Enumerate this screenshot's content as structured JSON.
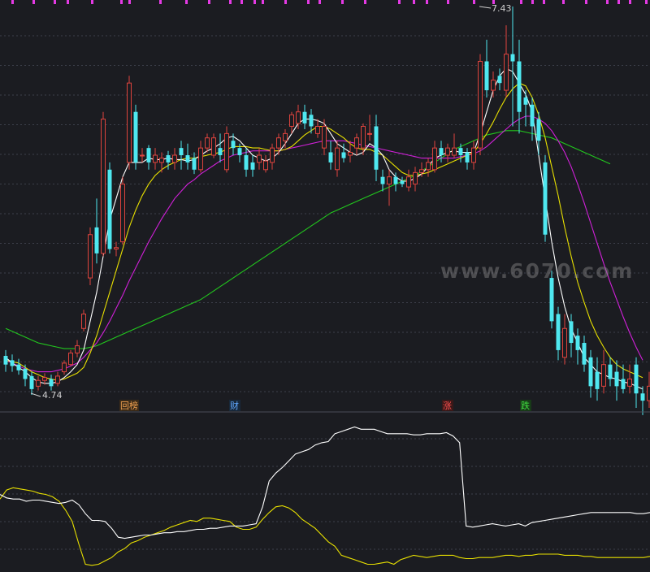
{
  "watermark": "www.6070.com",
  "colors": {
    "background": "#1b1c21",
    "grid": "#3c3f4a",
    "up_candle": "#e0443e",
    "down_candle": "#4fe8f0",
    "ma5": "#ffffff",
    "ma10": "#e8e000",
    "ma20": "#d020d8",
    "ma60": "#22c81e",
    "osc1": "#ffffff",
    "osc2": "#e8e000",
    "top_marks": "#e43ae4"
  },
  "markers": [
    {
      "text": "回榜",
      "color": "#f0a050"
    },
    {
      "text": "财",
      "color": "#60a8ff"
    },
    {
      "text": "涨",
      "color": "#ff5050"
    },
    {
      "text": "跌",
      "color": "#40e040"
    }
  ],
  "chart_data": {
    "type": "candlestick",
    "high_label": "7.43",
    "low_label": "4.74",
    "price_range": [
      4.74,
      7.43
    ],
    "candles": [
      [
        5.01,
        4.95,
        5.05,
        4.9
      ],
      [
        4.98,
        4.94,
        5.02,
        4.9
      ],
      [
        4.95,
        4.91,
        4.99,
        4.88
      ],
      [
        4.92,
        4.85,
        4.95,
        4.8
      ],
      [
        4.87,
        4.78,
        4.9,
        4.74
      ],
      [
        4.8,
        4.84,
        4.87,
        4.77
      ],
      [
        4.84,
        4.86,
        4.89,
        4.81
      ],
      [
        4.85,
        4.8,
        4.88,
        4.77
      ],
      [
        4.82,
        4.87,
        4.9,
        4.8
      ],
      [
        4.9,
        4.96,
        4.98,
        4.88
      ],
      [
        4.95,
        5.03,
        5.05,
        4.94
      ],
      [
        5.03,
        5.08,
        5.12,
        5.0
      ],
      [
        5.2,
        5.3,
        5.33,
        5.18
      ],
      [
        5.55,
        5.85,
        5.9,
        5.5
      ],
      [
        5.9,
        5.72,
        6.1,
        5.65
      ],
      [
        5.72,
        6.65,
        6.7,
        5.7
      ],
      [
        6.3,
        5.75,
        6.35,
        5.72
      ],
      [
        5.75,
        5.76,
        5.8,
        5.7
      ],
      [
        5.8,
        6.2,
        6.25,
        5.78
      ],
      [
        6.35,
        6.9,
        6.95,
        6.3
      ],
      [
        6.7,
        6.35,
        6.75,
        6.3
      ],
      [
        6.4,
        6.4,
        6.45,
        6.35
      ],
      [
        6.45,
        6.35,
        6.47,
        6.3
      ],
      [
        6.35,
        6.4,
        6.45,
        6.3
      ],
      [
        6.35,
        6.38,
        6.42,
        6.28
      ],
      [
        6.4,
        6.35,
        6.43,
        6.3
      ],
      [
        6.35,
        6.4,
        6.45,
        6.3
      ],
      [
        6.45,
        6.4,
        6.5,
        6.3
      ],
      [
        6.4,
        6.35,
        6.48,
        6.3
      ],
      [
        6.38,
        6.3,
        6.42,
        6.27
      ],
      [
        6.3,
        6.45,
        6.5,
        6.28
      ],
      [
        6.45,
        6.52,
        6.55,
        6.42
      ],
      [
        6.4,
        6.52,
        6.55,
        6.38
      ],
      [
        6.45,
        6.4,
        6.55,
        6.35
      ],
      [
        6.3,
        6.55,
        6.6,
        6.28
      ],
      [
        6.5,
        6.45,
        6.55,
        6.4
      ],
      [
        6.45,
        6.4,
        6.48,
        6.35
      ],
      [
        6.4,
        6.3,
        6.45,
        6.25
      ],
      [
        6.35,
        6.3,
        6.4,
        6.25
      ],
      [
        6.35,
        6.4,
        6.45,
        6.3
      ],
      [
        6.3,
        6.36,
        6.4,
        6.28
      ],
      [
        6.35,
        6.45,
        6.48,
        6.3
      ],
      [
        6.45,
        6.52,
        6.55,
        6.4
      ],
      [
        6.5,
        6.55,
        6.58,
        6.45
      ],
      [
        6.6,
        6.68,
        6.7,
        6.55
      ],
      [
        6.62,
        6.7,
        6.75,
        6.58
      ],
      [
        6.7,
        6.62,
        6.75,
        6.58
      ],
      [
        6.68,
        6.6,
        6.72,
        6.55
      ],
      [
        6.55,
        6.6,
        6.65,
        6.52
      ],
      [
        6.45,
        6.6,
        6.65,
        6.4
      ],
      [
        6.42,
        6.35,
        6.5,
        6.3
      ],
      [
        6.3,
        6.45,
        6.5,
        6.25
      ],
      [
        6.42,
        6.38,
        6.48,
        6.35
      ],
      [
        6.4,
        6.42,
        6.5,
        6.35
      ],
      [
        6.45,
        6.52,
        6.55,
        6.4
      ],
      [
        6.45,
        6.6,
        6.62,
        6.4
      ],
      [
        6.55,
        6.55,
        6.68,
        6.5
      ],
      [
        6.6,
        6.3,
        6.68,
        6.22
      ],
      [
        6.25,
        6.2,
        6.3,
        6.15
      ],
      [
        6.2,
        6.25,
        6.3,
        6.05
      ],
      [
        6.25,
        6.2,
        6.28,
        6.15
      ],
      [
        6.22,
        6.2,
        6.25,
        6.18
      ],
      [
        6.18,
        6.25,
        6.3,
        6.15
      ],
      [
        6.2,
        6.28,
        6.32,
        6.15
      ],
      [
        6.28,
        6.3,
        6.35,
        6.25
      ],
      [
        6.3,
        6.35,
        6.38,
        6.25
      ],
      [
        6.3,
        6.45,
        6.5,
        6.28
      ],
      [
        6.45,
        6.4,
        6.5,
        6.35
      ],
      [
        6.4,
        6.45,
        6.48,
        6.35
      ],
      [
        6.4,
        6.45,
        6.55,
        6.38
      ],
      [
        6.45,
        6.4,
        6.48,
        6.35
      ],
      [
        6.42,
        6.35,
        6.45,
        6.3
      ],
      [
        6.35,
        6.45,
        6.5,
        6.3
      ],
      [
        6.45,
        7.05,
        7.1,
        6.4
      ],
      [
        7.05,
        6.85,
        7.2,
        6.8
      ],
      [
        6.85,
        6.92,
        6.98,
        6.8
      ],
      [
        6.95,
        6.9,
        7.0,
        6.85
      ],
      [
        6.85,
        7.1,
        7.3,
        6.8
      ],
      [
        7.1,
        7.05,
        7.43,
        6.6
      ],
      [
        7.05,
        6.7,
        7.2,
        6.55
      ],
      [
        6.8,
        6.75,
        6.85,
        6.6
      ],
      [
        6.75,
        6.6,
        6.8,
        6.5
      ],
      [
        6.65,
        6.5,
        6.7,
        6.4
      ],
      [
        6.35,
        5.85,
        6.4,
        5.8
      ],
      [
        5.55,
        5.25,
        5.6,
        5.2
      ],
      [
        5.3,
        5.05,
        5.35,
        4.98
      ],
      [
        5.0,
        5.2,
        5.3,
        4.95
      ],
      [
        5.25,
        5.1,
        5.3,
        5.0
      ],
      [
        5.15,
        5.05,
        5.2,
        4.95
      ],
      [
        5.1,
        4.95,
        5.15,
        4.9
      ],
      [
        5.0,
        4.8,
        5.05,
        4.72
      ],
      [
        4.9,
        4.78,
        5.0,
        4.7
      ],
      [
        4.8,
        4.95,
        5.05,
        4.75
      ],
      [
        4.95,
        4.85,
        5.0,
        4.8
      ],
      [
        4.9,
        4.8,
        4.98,
        4.7
      ],
      [
        4.85,
        4.78,
        4.95,
        4.75
      ],
      [
        4.8,
        4.85,
        4.95,
        4.75
      ],
      [
        4.95,
        4.75,
        5.0,
        4.65
      ],
      [
        4.75,
        4.7,
        4.8,
        4.6
      ],
      [
        4.7,
        4.8,
        4.9,
        4.65
      ]
    ],
    "ma5": [
      5.0,
      4.96,
      4.93,
      4.9,
      4.86,
      4.83,
      4.82,
      4.82,
      4.83,
      4.86,
      4.9,
      4.95,
      5.05,
      5.25,
      5.45,
      5.7,
      5.95,
      6.1,
      6.25,
      6.35,
      6.35,
      6.35,
      6.38,
      6.37,
      6.37,
      6.38,
      6.37,
      6.37,
      6.36,
      6.37,
      6.4,
      6.43,
      6.45,
      6.48,
      6.52,
      6.53,
      6.5,
      6.45,
      6.4,
      6.38,
      6.36,
      6.38,
      6.42,
      6.48,
      6.55,
      6.62,
      6.65,
      6.65,
      6.64,
      6.62,
      6.55,
      6.48,
      6.45,
      6.42,
      6.4,
      6.42,
      6.48,
      6.45,
      6.4,
      6.3,
      6.25,
      6.22,
      6.22,
      6.24,
      6.27,
      6.32,
      6.38,
      6.4,
      6.42,
      6.43,
      6.42,
      6.42,
      6.42,
      6.55,
      6.7,
      6.85,
      6.95,
      7.0,
      6.98,
      6.9,
      6.82,
      6.7,
      6.4,
      6.1,
      5.8,
      5.55,
      5.35,
      5.2,
      5.1,
      5.0,
      4.95,
      4.9,
      4.88,
      4.86,
      4.85,
      4.83,
      4.82,
      4.8,
      4.78
    ],
    "ma10": [
      4.98,
      4.97,
      4.96,
      4.93,
      4.9,
      4.88,
      4.86,
      4.85,
      4.84,
      4.85,
      4.87,
      4.89,
      4.93,
      5.03,
      5.15,
      5.3,
      5.45,
      5.6,
      5.75,
      5.9,
      6.02,
      6.12,
      6.2,
      6.26,
      6.3,
      6.33,
      6.35,
      6.37,
      6.38,
      6.38,
      6.39,
      6.4,
      6.41,
      6.42,
      6.44,
      6.46,
      6.46,
      6.46,
      6.45,
      6.45,
      6.44,
      6.43,
      6.43,
      6.44,
      6.46,
      6.5,
      6.54,
      6.57,
      6.6,
      6.6,
      6.58,
      6.55,
      6.52,
      6.48,
      6.45,
      6.44,
      6.44,
      6.42,
      6.4,
      6.36,
      6.32,
      6.28,
      6.26,
      6.26,
      6.27,
      6.28,
      6.3,
      6.32,
      6.34,
      6.36,
      6.38,
      6.4,
      6.42,
      6.48,
      6.55,
      6.63,
      6.72,
      6.8,
      6.86,
      6.9,
      6.88,
      6.8,
      6.68,
      6.52,
      6.32,
      6.12,
      5.9,
      5.7,
      5.52,
      5.38,
      5.25,
      5.15,
      5.07,
      5.0,
      4.95,
      4.92,
      4.9,
      4.88,
      4.86
    ],
    "ma20": [
      4.98,
      4.96,
      4.94,
      4.92,
      4.91,
      4.9,
      4.9,
      4.9,
      4.91,
      4.92,
      4.94,
      4.96,
      5.0,
      5.05,
      5.1,
      5.17,
      5.25,
      5.34,
      5.43,
      5.53,
      5.62,
      5.71,
      5.8,
      5.88,
      5.96,
      6.03,
      6.1,
      6.15,
      6.2,
      6.23,
      6.27,
      6.3,
      6.33,
      6.36,
      6.38,
      6.4,
      6.41,
      6.42,
      6.43,
      6.43,
      6.43,
      6.43,
      6.43,
      6.44,
      6.45,
      6.46,
      6.47,
      6.48,
      6.49,
      6.5,
      6.5,
      6.5,
      6.5,
      6.49,
      6.48,
      6.47,
      6.46,
      6.45,
      6.44,
      6.43,
      6.42,
      6.41,
      6.4,
      6.39,
      6.38,
      6.38,
      6.38,
      6.38,
      6.38,
      6.38,
      6.39,
      6.4,
      6.41,
      6.43,
      6.46,
      6.5,
      6.54,
      6.58,
      6.62,
      6.65,
      6.67,
      6.67,
      6.65,
      6.62,
      6.57,
      6.5,
      6.42,
      6.32,
      6.2,
      6.07,
      5.93,
      5.79,
      5.65,
      5.52,
      5.4,
      5.28,
      5.17,
      5.07,
      4.98
    ],
    "ma60": [
      5.2,
      5.18,
      5.16,
      5.14,
      5.12,
      5.1,
      5.09,
      5.08,
      5.07,
      5.06,
      5.06,
      5.06,
      5.06,
      5.07,
      5.08,
      5.1,
      5.12,
      5.14,
      5.16,
      5.18,
      5.2,
      5.22,
      5.24,
      5.26,
      5.28,
      5.3,
      5.32,
      5.34,
      5.36,
      5.38,
      5.4,
      5.43,
      5.46,
      5.49,
      5.52,
      5.55,
      5.58,
      5.61,
      5.64,
      5.67,
      5.7,
      5.73,
      5.76,
      5.79,
      5.82,
      5.85,
      5.88,
      5.91,
      5.94,
      5.97,
      6.0,
      6.02,
      6.04,
      6.06,
      6.08,
      6.1,
      6.12,
      6.14,
      6.16,
      6.18,
      6.2,
      6.22,
      6.24,
      6.26,
      6.29,
      6.32,
      6.35,
      6.38,
      6.41,
      6.44,
      6.46,
      6.48,
      6.5,
      6.52,
      6.54,
      6.55,
      6.56,
      6.57,
      6.57,
      6.57,
      6.56,
      6.55,
      6.54,
      6.53,
      6.52,
      6.5,
      6.48,
      6.46,
      6.44,
      6.42,
      6.4,
      6.38,
      6.36,
      6.34
    ],
    "osc1": [
      26,
      23,
      22,
      22,
      20,
      21,
      21,
      20,
      19,
      18,
      19,
      21,
      17,
      9,
      3,
      3,
      2,
      -4,
      -12,
      -13,
      -12,
      -11,
      -10,
      -10,
      -9,
      -8,
      -8,
      -7,
      -7,
      -6,
      -5,
      -5,
      -4,
      -4,
      -3,
      -2,
      -2,
      -2,
      -1,
      0,
      15,
      38,
      45,
      50,
      56,
      62,
      64,
      66,
      70,
      72,
      73,
      80,
      82,
      84,
      86,
      84,
      84,
      84,
      82,
      80,
      80,
      80,
      80,
      79,
      79,
      80,
      80,
      80,
      81,
      78,
      72,
      -2,
      -3,
      -2,
      -1,
      0,
      -1,
      -2,
      -1,
      0,
      -2,
      1,
      2,
      3,
      4,
      5,
      6,
      7,
      8,
      9,
      10,
      10,
      10,
      10,
      10,
      10,
      10,
      9,
      9,
      10
    ],
    "osc2": [
      22,
      30,
      32,
      31,
      30,
      29,
      27,
      26,
      24,
      20,
      12,
      2,
      -18,
      -36,
      -37,
      -36,
      -33,
      -30,
      -25,
      -22,
      -17,
      -15,
      -12,
      -10,
      -8,
      -6,
      -3,
      -1,
      1,
      3,
      2,
      5,
      5,
      4,
      3,
      2,
      -3,
      -5,
      -5,
      -3,
      4,
      10,
      15,
      16,
      14,
      10,
      4,
      0,
      -4,
      -10,
      -16,
      -20,
      -28,
      -30,
      -32,
      -34,
      -36,
      -36,
      -35,
      -34,
      -36,
      -32,
      -30,
      -28,
      -29,
      -30,
      -29,
      -28,
      -28,
      -28,
      -30,
      -31,
      -31,
      -30,
      -30,
      -30,
      -29,
      -28,
      -28,
      -29,
      -28,
      -28,
      -27,
      -27,
      -27,
      -27,
      -28,
      -28,
      -28,
      -29,
      -29,
      -30,
      -30,
      -30,
      -30,
      -30,
      -30,
      -30,
      -30,
      -29
    ]
  }
}
